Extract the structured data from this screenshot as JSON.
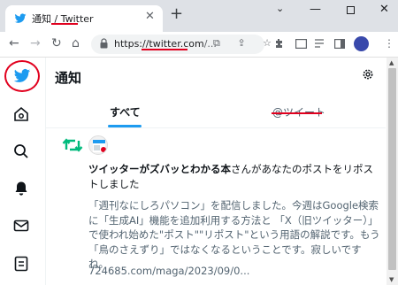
{
  "browser": {
    "tab_title": "通知 / Twitter",
    "new_tab": "+",
    "url_host": "https://twitter.com",
    "url_path": "/...",
    "window_controls": {
      "dropdown": "⌄",
      "minimize": "—",
      "close": "✕"
    }
  },
  "icons": {
    "tab_favicon": "twitter-bird-icon",
    "back": "←",
    "forward": "→",
    "reload": "↻",
    "home": "⌂",
    "omnibox_extras": "⧉ ⇪ ☆",
    "extensions": "extensions-icon",
    "menu": "⋮"
  },
  "page": {
    "title": "通知",
    "tabs": [
      {
        "label": "すべて",
        "active": true
      },
      {
        "label": "@ツイート",
        "active": false
      }
    ],
    "notification": {
      "account_name": "ツイッターがズバッとわかる本",
      "action_text": "さんがあなたのポストをリポストしました",
      "body": "「週刊なにしろパソコン」を配信しました。今週はGoogle検索に「生成AI」機能を追加利用する方法と 「X（旧ツイッター）」で使われ始めた\"ポスト\"\"リポスト\"という用語の解説です。もう「鳥のさえずり」ではなくなるということです。寂しいですね。",
      "link": "724685.com/maga/2023/09/0..."
    }
  },
  "colors": {
    "brand_blue": "#1d9bf0",
    "retweet_green": "#00ba7c",
    "annotation_red": "#e1001e"
  }
}
